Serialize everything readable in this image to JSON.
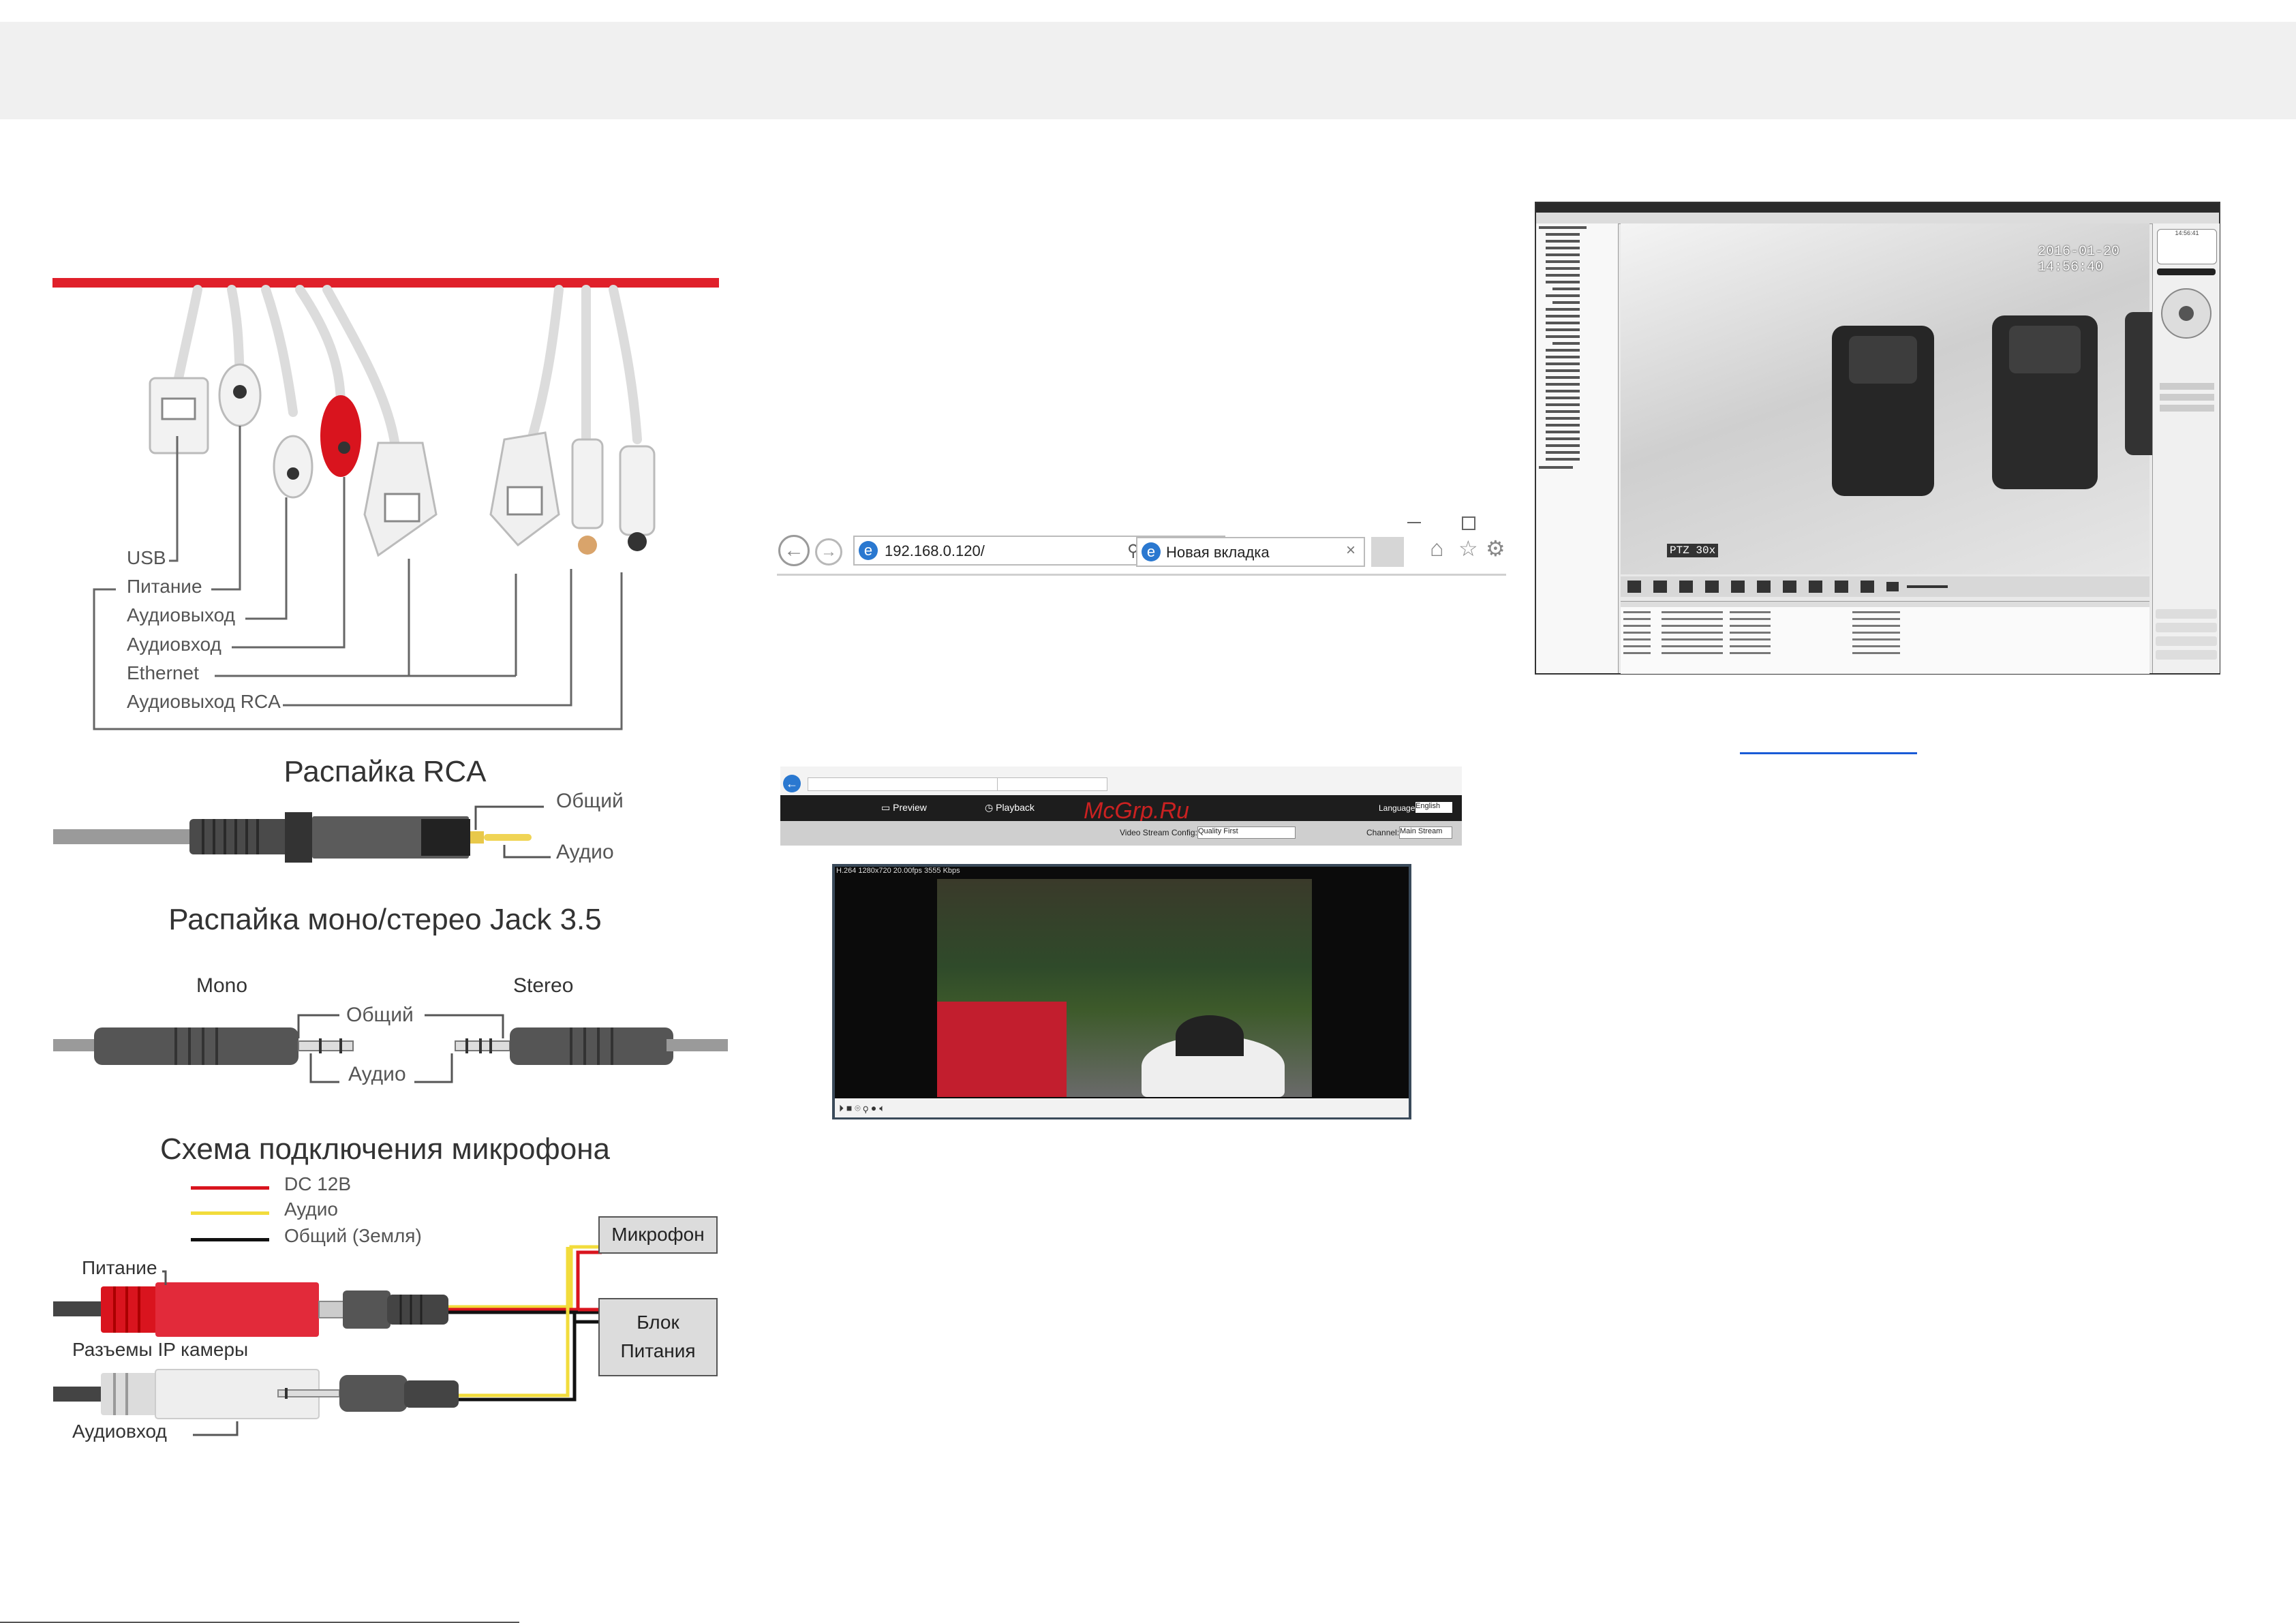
{
  "connectors": {
    "labels": [
      "USB",
      "Питание",
      "Аудиовыход",
      "Аудиовход",
      "Ethernet",
      "Аудиовыход RCA"
    ]
  },
  "rca": {
    "title": "Распайка RCA",
    "common": "Общий",
    "audio": "Аудио"
  },
  "jack": {
    "title": "Распайка моно/стерео Jack 3.5",
    "mono": "Mono",
    "stereo": "Stereo",
    "common": "Общий",
    "audio": "Аудио"
  },
  "mic": {
    "title": "Схема подключения микрофона",
    "legend": [
      {
        "label": "DC 12В",
        "color": "#d9141e"
      },
      {
        "label": "Аудио",
        "color": "#f2dc3c"
      },
      {
        "label": "Общий (Земля)",
        "color": "#111111"
      }
    ],
    "power_label": "Питание",
    "camera_label": "Разъемы IP камеры",
    "audio_in_label": "Аудиовход",
    "microphone_box": "Микрофон",
    "psu_box": [
      "Блок",
      "Питания"
    ]
  },
  "browser": {
    "address": "192.168.0.120/",
    "tab_title": "Новая вкладка"
  },
  "webui": {
    "menu_preview": "Preview",
    "menu_playback": "Playback",
    "watermark": "McGrp.Ru",
    "language_label": "Language:",
    "language_value": "English",
    "stream_config_label": "Video Stream Config:",
    "stream_config_value": "Quality First",
    "channel_label": "Channel:",
    "channel_value": "Main Stream",
    "video_info": "H.264 1280x720 20.00fps 3555 Kbps"
  },
  "cms": {
    "timestamp": "2016-01-20 14:56:40",
    "ptz_label": "PTZ 30x",
    "clock_time": "14:56:41"
  },
  "colors": {
    "accent_red": "#e0202a",
    "link_blue": "#1a5bd6",
    "band_gray": "#f0f0f0"
  }
}
